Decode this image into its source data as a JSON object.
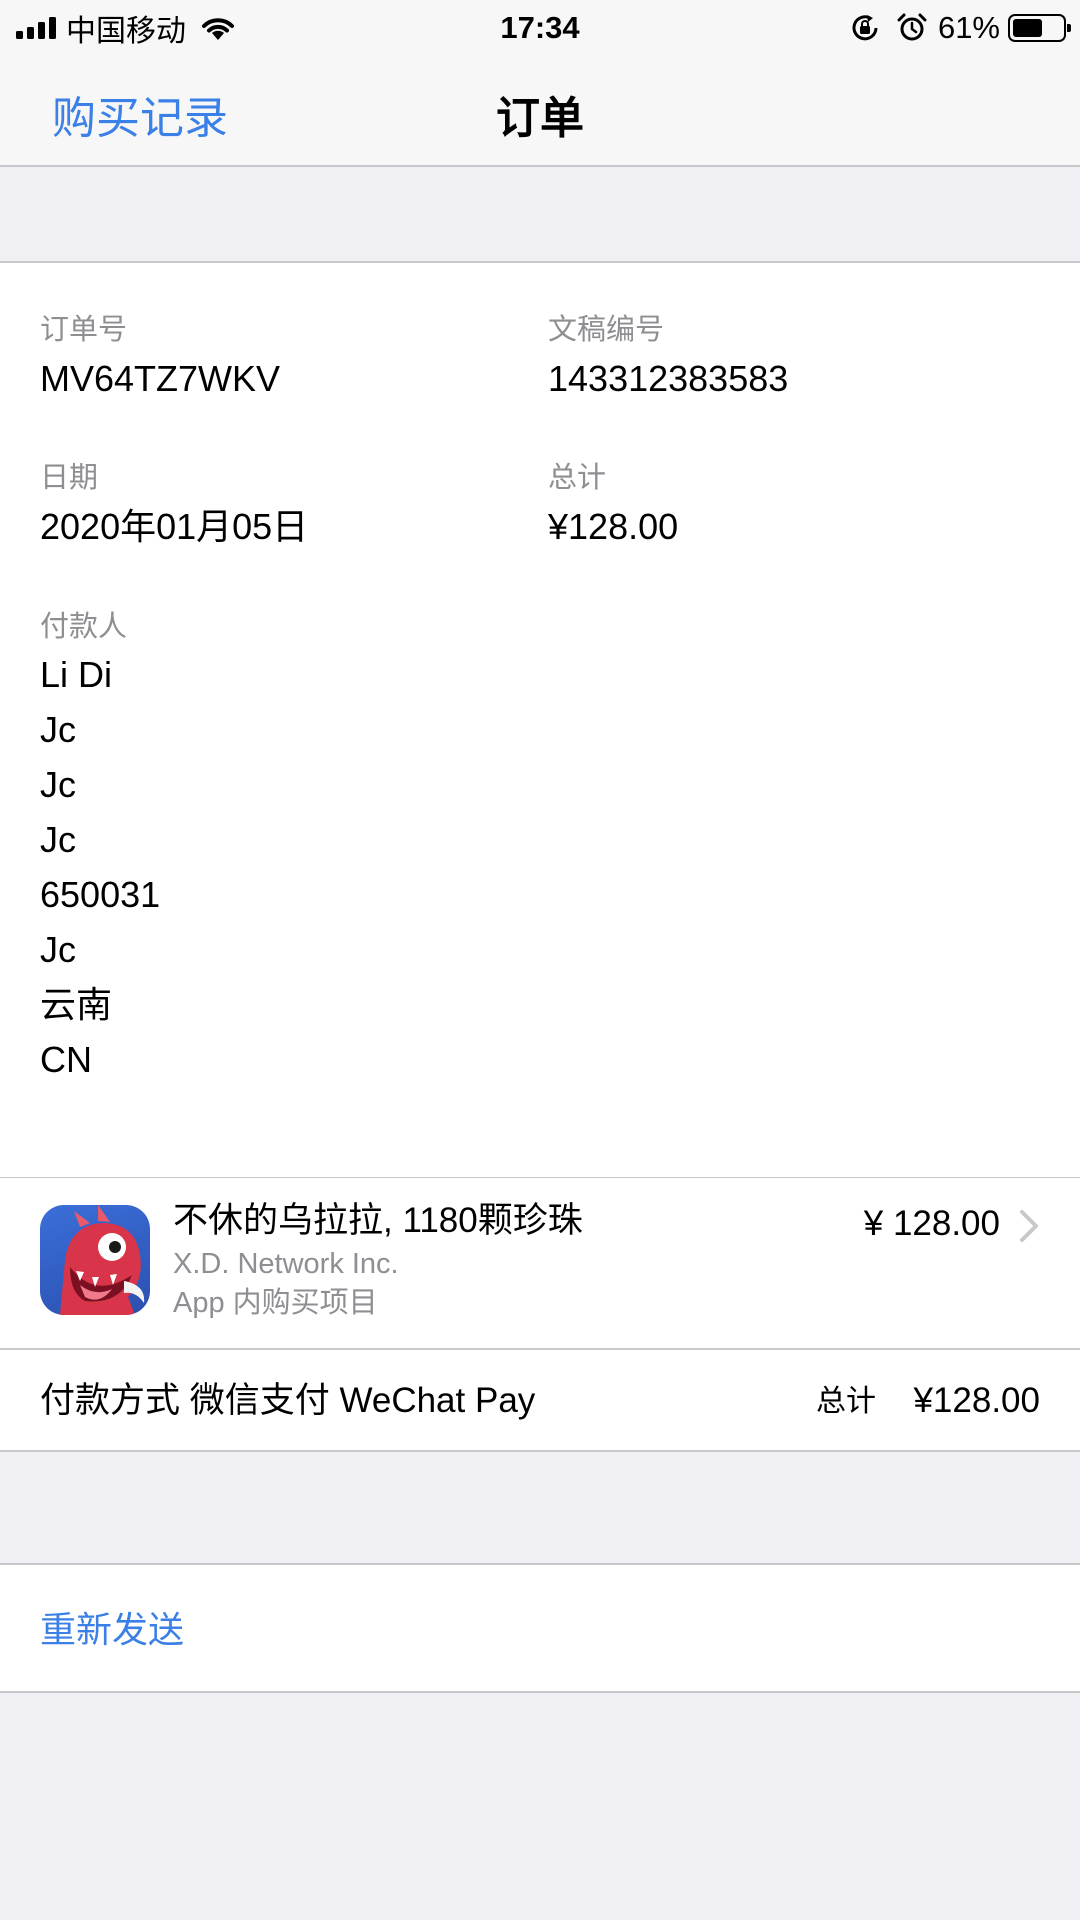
{
  "status_bar": {
    "carrier": "中国移动",
    "time": "17:34",
    "battery_percent": "61%",
    "battery_level": 0.61,
    "icons": [
      "signal-bars-icon",
      "wifi-icon",
      "orientation-lock-icon",
      "alarm-icon",
      "battery-icon"
    ]
  },
  "nav": {
    "back_label": "购买记录",
    "title": "订单"
  },
  "order": {
    "order_number_label": "订单号",
    "order_number": "MV64TZ7WKV",
    "document_number_label": "文稿编号",
    "document_number": "143312383583",
    "date_label": "日期",
    "date": "2020年01月05日",
    "total_label": "总计",
    "total": "¥128.00",
    "payer_label": "付款人",
    "payer_lines": [
      "Li Di",
      "Jc",
      "Jc",
      "Jc",
      "650031",
      "Jc",
      "云南",
      "CN"
    ]
  },
  "product": {
    "name": "不休的乌拉拉, 1180颗珍珠",
    "developer": "X.D. Network Inc.",
    "type": "App 内购买项目",
    "price": "¥ 128.00",
    "icon": "dragon-app-icon"
  },
  "payment": {
    "method": "付款方式 微信支付 WeChat Pay",
    "total_label": "总计",
    "total": "¥128.00"
  },
  "actions": {
    "resend_label": "重新发送"
  },
  "colors": {
    "accent": "#3b80e6",
    "secondary_text": "#8e8e93",
    "background": "#efeff4",
    "separator": "#c8c7cc"
  }
}
